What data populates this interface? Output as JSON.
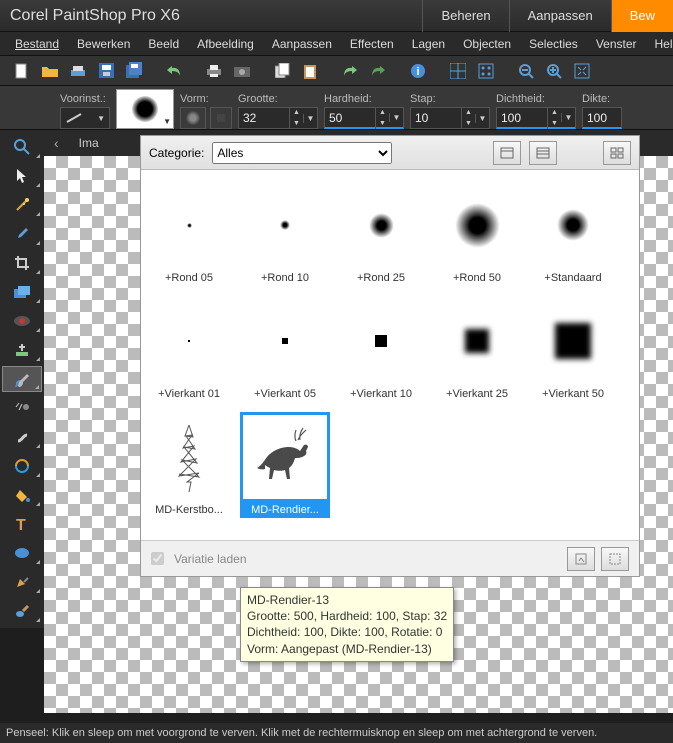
{
  "app": {
    "title": "Corel PaintShop Pro X6"
  },
  "header_tabs": {
    "manage": "Beheren",
    "adjust": "Aanpassen",
    "edit": "Bew"
  },
  "menu": {
    "file": "Bestand",
    "edit": "Bewerken",
    "image": "Beeld",
    "picture": "Afbeelding",
    "adjust": "Aanpassen",
    "effects": "Effecten",
    "layers": "Lagen",
    "objects": "Objecten",
    "selections": "Selecties",
    "window": "Venster",
    "help": "Help"
  },
  "options": {
    "preset_label": "Voorinst.:",
    "shape_label": "Vorm:",
    "size_label": "Grootte:",
    "hardness_label": "Hardheid:",
    "step_label": "Stap:",
    "density_label": "Dichtheid:",
    "thickness_label": "Dikte:",
    "size_value": "32",
    "hardness_value": "50",
    "step_value": "10",
    "density_value": "100",
    "thickness_value": "100"
  },
  "doc_tab": "Ima",
  "popup": {
    "category_label": "Categorie:",
    "category_value": "Alles",
    "variation_label": "Variatie laden",
    "items": {
      "r05": "+Rond 05",
      "r10": "+Rond 10",
      "r25": "+Rond 25",
      "r50": "+Rond 50",
      "std": "+Standaard",
      "v01": "+Vierkant 01",
      "v05": "+Vierkant 05",
      "v10": "+Vierkant 10",
      "v25": "+Vierkant 25",
      "v50": "+Vierkant 50",
      "tree": "MD-Kerstbo...",
      "deer": "MD-Rendier..."
    }
  },
  "tooltip": {
    "title": "MD-Rendier-13",
    "line2": "Grootte: 500, Hardheid: 100, Stap: 32",
    "line3": "Dichtheid: 100, Dikte: 100, Rotatie: 0",
    "line4": "Vorm: Aangepast (MD-Rendier-13)"
  },
  "status": "Penseel: Klik en sleep om met voorgrond te verven. Klik met de rechtermuisknop en sleep om met achtergrond te verven."
}
